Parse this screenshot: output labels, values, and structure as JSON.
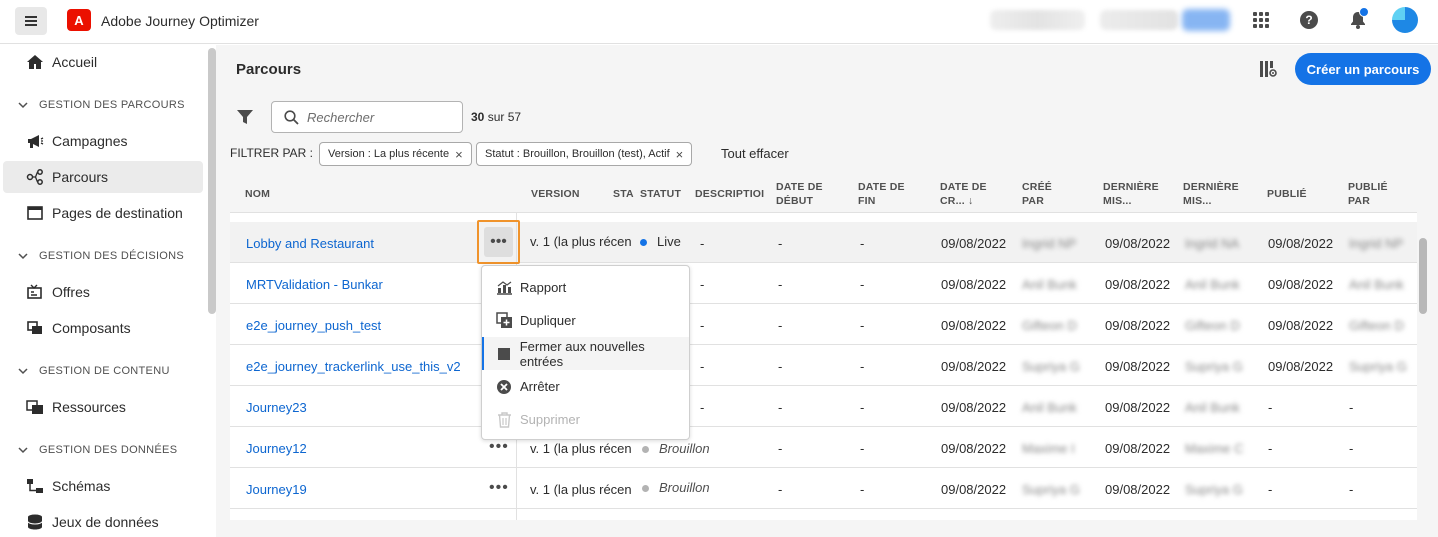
{
  "app": {
    "title": "Adobe Journey Optimizer",
    "logo_letter": "A"
  },
  "topbar": {
    "help_glyph": "?"
  },
  "sidebar": {
    "home": "Accueil",
    "sections": [
      {
        "title": "GESTION DES PARCOURS",
        "items": [
          "Campagnes",
          "Parcours",
          "Pages de destination"
        ]
      },
      {
        "title": "GESTION DES DÉCISIONS",
        "items": [
          "Offres",
          "Composants"
        ]
      },
      {
        "title": "GESTION DE CONTENU",
        "items": [
          "Ressources"
        ]
      },
      {
        "title": "GESTION DES DONNÉES",
        "items": [
          "Schémas",
          "Jeux de données"
        ]
      }
    ],
    "active_item": "Parcours"
  },
  "page": {
    "title": "Parcours",
    "create_button": "Créer un parcours",
    "search_placeholder": "Rechercher",
    "count_shown": "30",
    "count_rest": "sur 57",
    "filter_label": "FILTRER PAR :",
    "chips": [
      "Version : La plus récente",
      "Statut : Brouillon, Brouillon (test), Actif"
    ],
    "chip_close_glyph": "×",
    "clear_all": "Tout effacer"
  },
  "table": {
    "headers": {
      "nom": "NOM",
      "version": "VERSION",
      "sta": "STA",
      "statut": "STATUT",
      "description": "DESCRIPTIOI",
      "date_debut_1": "DATE DE",
      "date_debut_2": "DÉBUT",
      "date_fin_1": "DATE DE",
      "date_fin_2": "FIN",
      "date_cr_1": "DATE DE",
      "date_cr_2": "CR... ↓",
      "cree_par_1": "CRÉÉ",
      "cree_par_2": "PAR",
      "derniere_1_1": "DERNIÈRE",
      "derniere_1_2": "MIS...",
      "derniere_2_1": "DERNIÈRE",
      "derniere_2_2": "MIS...",
      "publie": "PUBLIÉ",
      "publie_par_1": "PUBLIÉ",
      "publie_par_2": "PAR"
    },
    "more_glyph": "•••",
    "rows": [
      {
        "name": "Lobby and Restaurant",
        "version": "v. 1 (la plus récen",
        "status": "Live",
        "status_color": "#1473e6",
        "description": "-",
        "start": "-",
        "end": "-",
        "created": "09/08/2022",
        "created_by": "Ingrid NP",
        "modified": "09/08/2022",
        "modified_by": "Ingrid NA",
        "published": "09/08/2022",
        "published_by": "Ingrid NP"
      },
      {
        "name": "MRTValidation - Bunkar",
        "version": "",
        "status": "",
        "status_color": "",
        "description": "-",
        "start": "-",
        "end": "-",
        "created": "09/08/2022",
        "created_by": "Anil Bunk",
        "modified": "09/08/2022",
        "modified_by": "Anil Bunk",
        "published": "09/08/2022",
        "published_by": "Anil Bunk"
      },
      {
        "name": "e2e_journey_push_test",
        "version": "",
        "status": "",
        "status_color": "",
        "description": "-",
        "start": "-",
        "end": "-",
        "created": "09/08/2022",
        "created_by": "Gifteon D",
        "modified": "09/08/2022",
        "modified_by": "Gifteon D",
        "published": "09/08/2022",
        "published_by": "Gifteon D"
      },
      {
        "name": "e2e_journey_trackerlink_use_this_v2",
        "version": "",
        "status": "",
        "status_color": "",
        "description": "-",
        "start": "-",
        "end": "-",
        "created": "09/08/2022",
        "created_by": "Supriya G",
        "modified": "09/08/2022",
        "modified_by": "Supriya G",
        "published": "09/08/2022",
        "published_by": "Supriya G"
      },
      {
        "name": "Journey23",
        "version": "",
        "status": "",
        "status_color": "",
        "description": "-",
        "start": "-",
        "end": "-",
        "created": "09/08/2022",
        "created_by": "Anil Bunk",
        "modified": "09/08/2022",
        "modified_by": "Anil Bunk",
        "published": "-",
        "published_by": "-"
      },
      {
        "name": "Journey12",
        "version": "v. 1 (la plus récen",
        "status": "Brouillon",
        "status_color": "#b3b3b3",
        "description": "-",
        "start": "-",
        "end": "-",
        "created": "09/08/2022",
        "created_by": "Maxime I",
        "modified": "09/08/2022",
        "modified_by": "Maxime C",
        "published": "-",
        "published_by": "-"
      },
      {
        "name": "Journey19",
        "version": "v. 1 (la plus récen",
        "status": "Brouillon",
        "status_color": "#b3b3b3",
        "description": "-",
        "start": "-",
        "end": "-",
        "created": "09/08/2022",
        "created_by": "Supriya G",
        "modified": "09/08/2022",
        "modified_by": "Supriya G",
        "published": "-",
        "published_by": "-"
      }
    ]
  },
  "menu": {
    "items": [
      {
        "label": "Rapport",
        "icon": "chart-icon"
      },
      {
        "label": "Dupliquer",
        "icon": "duplicate-icon"
      },
      {
        "label": "Fermer aux nouvelles entrées",
        "icon": "stop-square-icon"
      },
      {
        "label": "Arrêter",
        "icon": "cancel-circle-icon"
      },
      {
        "label": "Supprimer",
        "icon": "trash-icon"
      }
    ],
    "highlighted_index": 2,
    "disabled_index": 4
  }
}
